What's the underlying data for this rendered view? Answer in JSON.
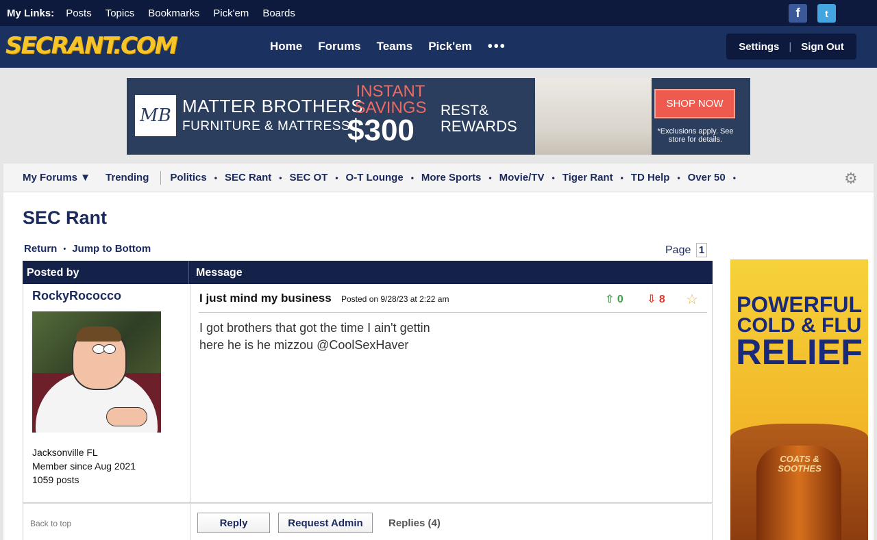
{
  "top_links": {
    "label": "My Links:",
    "items": [
      "Posts",
      "Topics",
      "Bookmarks",
      "Pick'em",
      "Boards"
    ],
    "facebook_icon": "f",
    "twitter_icon": "t"
  },
  "header": {
    "logo": "SECRANT.COM",
    "nav": [
      "Home",
      "Forums",
      "Teams",
      "Pick'em"
    ],
    "more": "•••",
    "settings": "Settings",
    "signout": "Sign Out"
  },
  "banner_ad": {
    "brand_mark": "MB",
    "brand_line1": "MATTER BROTHERS",
    "brand_line2": "FURNITURE & MATTRESS",
    "instant": "INSTANT SAVINGS",
    "price": "$300",
    "rest": "REST&",
    "rewards": "REWARDS",
    "cta": "SHOP NOW",
    "fine_print": "*Exclusions apply. See store for details."
  },
  "subnav": {
    "my_forums": "My Forums ▼",
    "trending": "Trending",
    "forums": [
      "Politics",
      "SEC Rant",
      "SEC OT",
      "O-T Lounge",
      "More Sports",
      "Movie/TV",
      "Tiger Rant",
      "TD Help",
      "Over 50"
    ],
    "trailing_dot": "•"
  },
  "forum": {
    "title": "SEC Rant",
    "return": "Return",
    "jump_bottom": "Jump to Bottom",
    "page_label": "Page",
    "page_number": "1"
  },
  "table": {
    "col_posted_by": "Posted by",
    "col_message": "Message"
  },
  "post": {
    "username": "RockyRococco",
    "location": "Jacksonville FL",
    "member_since": "Member since Aug 2021",
    "post_count": "1059 posts",
    "title": "I just mind my business",
    "posted_on": "Posted on 9/28/23 at 2:22 am",
    "upvotes": "0",
    "downvotes": "8",
    "body_line1": "I got brothers that got the time I ain't gettin",
    "body_line2": "here he is he mizzou @CoolSexHaver"
  },
  "post_footer": {
    "back_to_top": "Back to top",
    "reply": "Reply",
    "request_admin": "Request Admin",
    "replies": "Replies (4)"
  },
  "side_ad": {
    "line1": "POWERFUL",
    "line2": "COLD & FLU",
    "line3": "RELIEF",
    "product": "COATS & SOOTHES"
  },
  "colors": {
    "nav_dark": "#0d1a3e",
    "header": "#1b3160",
    "link": "#1b2a5c",
    "upvote": "#3aa142",
    "downvote": "#e0392c"
  }
}
